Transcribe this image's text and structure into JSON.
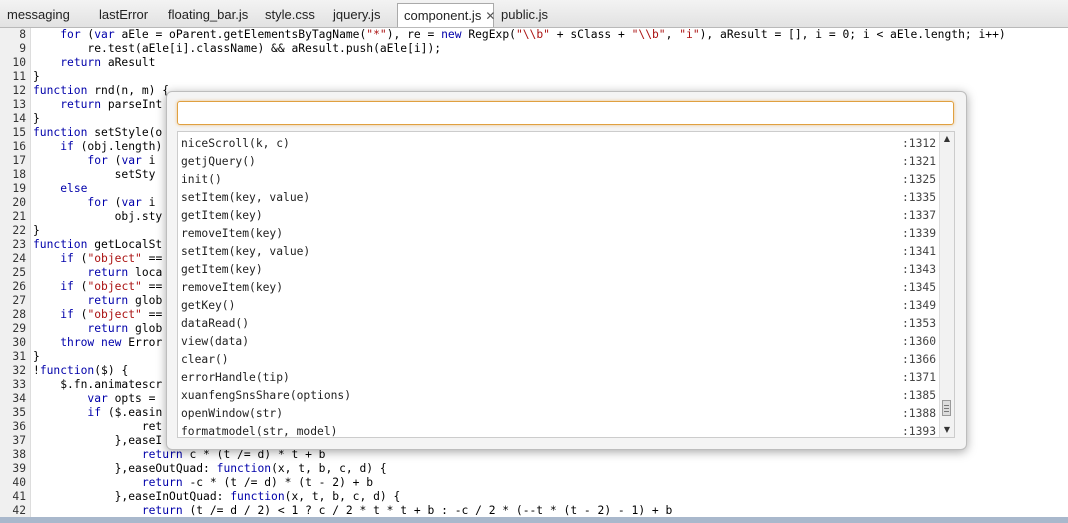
{
  "tabs": [
    {
      "label": "messaging",
      "active": false
    },
    {
      "label": "lastError",
      "active": false
    },
    {
      "label": "floating_bar.js",
      "active": false
    },
    {
      "label": "style.css",
      "active": false
    },
    {
      "label": "jquery.js",
      "active": false
    },
    {
      "label": "component.js",
      "active": true
    },
    {
      "label": "public.js",
      "active": false
    }
  ],
  "editor": {
    "lines": [
      {
        "n": "8",
        "text": "    for (var aEle = oParent.getElementsByTagName(\"*\"), re = new RegExp(\"\\\\b\" + sClass + \"\\\\b\", \"i\"), aResult = [], i = 0; i < aEle.length; i++)"
      },
      {
        "n": "9",
        "text": "        re.test(aEle[i].className) && aResult.push(aEle[i]);"
      },
      {
        "n": "10",
        "text": "    return aResult"
      },
      {
        "n": "11",
        "text": "}"
      },
      {
        "n": "12",
        "text": "function rnd(n, m) {"
      },
      {
        "n": "13",
        "text": "    return parseInt"
      },
      {
        "n": "14",
        "text": "}"
      },
      {
        "n": "15",
        "text": "function setStyle(o"
      },
      {
        "n": "16",
        "text": "    if (obj.length)"
      },
      {
        "n": "17",
        "text": "        for (var i"
      },
      {
        "n": "18",
        "text": "            setSty"
      },
      {
        "n": "19",
        "text": "    else"
      },
      {
        "n": "20",
        "text": "        for (var i"
      },
      {
        "n": "21",
        "text": "            obj.sty"
      },
      {
        "n": "22",
        "text": "}"
      },
      {
        "n": "23",
        "text": "function getLocalSt"
      },
      {
        "n": "24",
        "text": "    if (\"object\" =="
      },
      {
        "n": "25",
        "text": "        return loca"
      },
      {
        "n": "26",
        "text": "    if (\"object\" =="
      },
      {
        "n": "27",
        "text": "        return glob"
      },
      {
        "n": "28",
        "text": "    if (\"object\" =="
      },
      {
        "n": "29",
        "text": "        return glob"
      },
      {
        "n": "30",
        "text": "    throw new Error"
      },
      {
        "n": "31",
        "text": "}"
      },
      {
        "n": "32",
        "text": "!function($) {"
      },
      {
        "n": "33",
        "text": "    $.fn.animatescr"
      },
      {
        "n": "34",
        "text": "        var opts ="
      },
      {
        "n": "35",
        "text": "        if ($.easin"
      },
      {
        "n": "36",
        "text": "                ret"
      },
      {
        "n": "37",
        "text": "            },easeI"
      },
      {
        "n": "38",
        "text": "                return c * (t /= d) * t + b"
      },
      {
        "n": "39",
        "text": "            },easeOutQuad: function(x, t, b, c, d) {"
      },
      {
        "n": "40",
        "text": "                return -c * (t /= d) * (t - 2) + b"
      },
      {
        "n": "41",
        "text": "            },easeInOutQuad: function(x, t, b, c, d) {"
      },
      {
        "n": "42",
        "text": "                return (t /= d / 2) < 1 ? c / 2 * t * t + b : -c / 2 * (--t * (t - 2) - 1) + b"
      }
    ]
  },
  "goto": {
    "query": "",
    "items": [
      {
        "name": "niceScroll(k, c)",
        "line": ":1312"
      },
      {
        "name": "getjQuery()",
        "line": ":1321"
      },
      {
        "name": "init()",
        "line": ":1325"
      },
      {
        "name": "setItem(key, value)",
        "line": ":1335"
      },
      {
        "name": "getItem(key)",
        "line": ":1337"
      },
      {
        "name": "removeItem(key)",
        "line": ":1339"
      },
      {
        "name": "setItem(key, value)",
        "line": ":1341"
      },
      {
        "name": "getItem(key)",
        "line": ":1343"
      },
      {
        "name": "removeItem(key)",
        "line": ":1345"
      },
      {
        "name": "getKey()",
        "line": ":1349"
      },
      {
        "name": "dataRead()",
        "line": ":1353"
      },
      {
        "name": "view(data)",
        "line": ":1360"
      },
      {
        "name": "clear()",
        "line": ":1366"
      },
      {
        "name": "errorHandle(tip)",
        "line": ":1371"
      },
      {
        "name": "xuanfengSnsShare(options)",
        "line": ":1385"
      },
      {
        "name": "openWindow(str)",
        "line": ":1388"
      },
      {
        "name": "formatmodel(str, model)",
        "line": ":1393"
      }
    ]
  },
  "icons": {
    "close": "close-icon",
    "up": "arrow-up-icon",
    "down": "arrow-down-icon"
  }
}
